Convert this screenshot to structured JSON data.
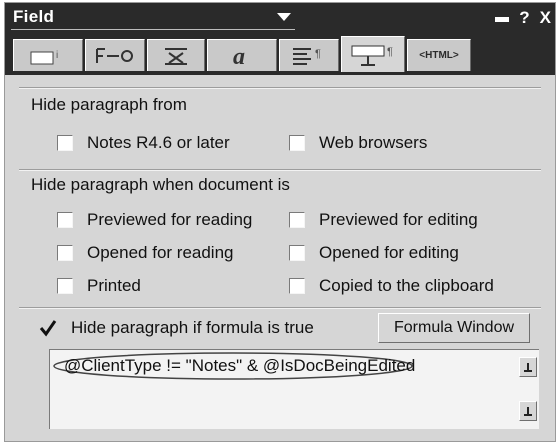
{
  "title": "Field",
  "tabs": [
    {
      "icon": "field-info-tab-icon"
    },
    {
      "icon": "field-options-tab-icon"
    },
    {
      "icon": "alignment-tab-icon"
    },
    {
      "icon": "font-tab-icon"
    },
    {
      "icon": "paragraph-tab-icon"
    },
    {
      "icon": "hide-when-tab-icon",
      "active": true
    },
    {
      "label": "HTML"
    }
  ],
  "sections": {
    "hide_from": "Hide paragraph from",
    "hide_when": "Hide paragraph when document is"
  },
  "options": {
    "notes_r46": {
      "label": "Notes R4.6 or later",
      "checked": false
    },
    "web_browsers": {
      "label": "Web browsers",
      "checked": false
    },
    "previewed_reading": {
      "label": "Previewed for reading",
      "checked": false
    },
    "previewed_editing": {
      "label": "Previewed for editing",
      "checked": false
    },
    "opened_reading": {
      "label": "Opened for reading",
      "checked": false
    },
    "opened_editing": {
      "label": "Opened for editing",
      "checked": false
    },
    "printed": {
      "label": "Printed",
      "checked": false
    },
    "copied_clipboard": {
      "label": "Copied to the clipboard",
      "checked": false
    },
    "hide_if_formula": {
      "label": "Hide paragraph if formula is true",
      "checked": true
    }
  },
  "formula_window_label": "Formula Window",
  "formula": "@ClientType != \"Notes\" & @IsDocBeingEdited",
  "titlebar_buttons": {
    "help": "?",
    "close": "X"
  }
}
